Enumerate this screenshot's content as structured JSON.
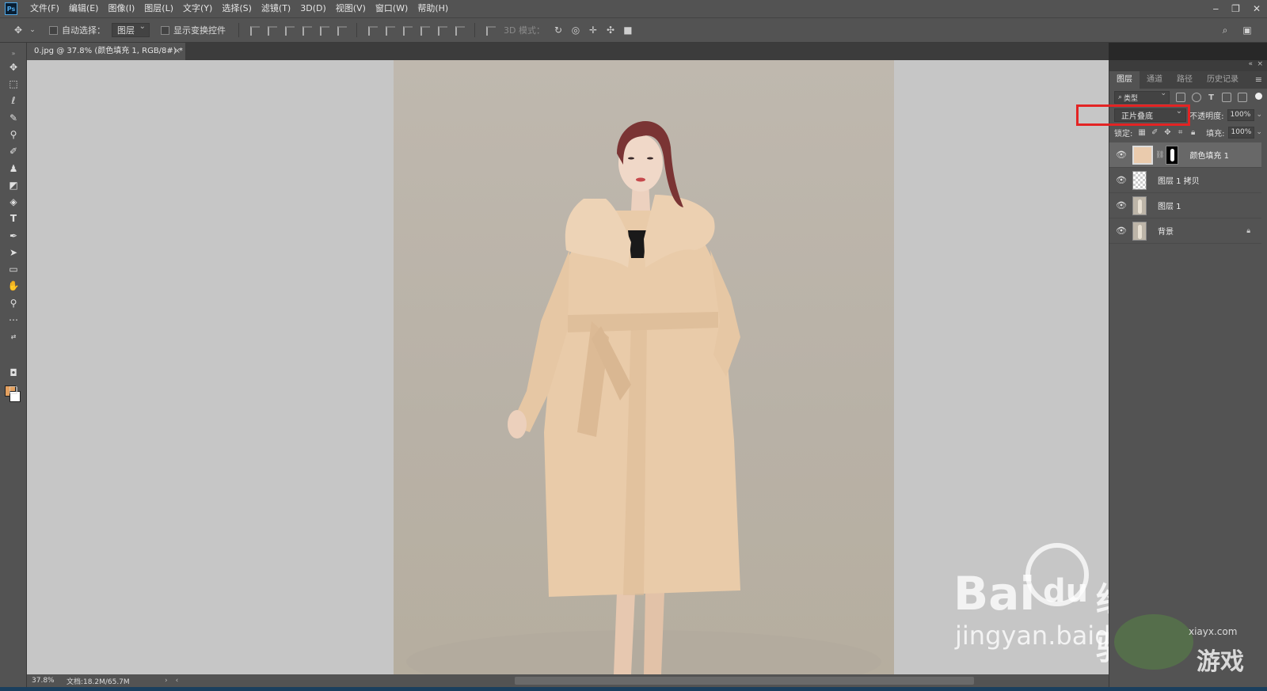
{
  "app": {
    "logo_text": "Ps"
  },
  "menu": [
    "文件(F)",
    "编辑(E)",
    "图像(I)",
    "图层(L)",
    "文字(Y)",
    "选择(S)",
    "滤镜(T)",
    "3D(D)",
    "视图(V)",
    "窗口(W)",
    "帮助(H)"
  ],
  "window_controls": {
    "minimize": "‒",
    "restore": "❐",
    "close": "✕"
  },
  "options": {
    "auto_select_label": "自动选择：",
    "auto_select_value": "图层",
    "transform_controls_label": "显示变换控件",
    "mode_3d_label": "3D 模式："
  },
  "document_tab": {
    "title": "0.jpg @ 37.8% (颜色填充 1, RGB/8#) *",
    "close": "×"
  },
  "status": {
    "zoom": "37.8%",
    "doc_info": "文档:18.2M/65.7M"
  },
  "panel": {
    "tabs": [
      "图层",
      "通道",
      "路径",
      "历史记录"
    ],
    "filter_kind": "类型",
    "blend_mode": "正片叠底",
    "opacity_label": "不透明度:",
    "opacity_value": "100%",
    "lock_label": "锁定:",
    "fill_label": "填充:",
    "fill_value": "100%"
  },
  "layers": [
    {
      "name": "颜色填充 1",
      "type": "fill",
      "selected": true,
      "visible": true
    },
    {
      "name": "图层 1 拷贝",
      "type": "transparent",
      "selected": false,
      "visible": true
    },
    {
      "name": "图层 1",
      "type": "photo",
      "selected": false,
      "visible": true
    },
    {
      "name": "背景",
      "type": "photo",
      "selected": false,
      "visible": true,
      "locked": true
    }
  ],
  "fill_color": "#eacbad",
  "foreground_color": "#e4a160",
  "background_color": "#ffffff",
  "highlight_color": "#e32424",
  "watermark": {
    "baidu_brand": "Bai",
    "baidu_du": "du",
    "baidu_cn": "经验",
    "baidu_url": "jingyan.baidu.com",
    "site_url": "xiayx.com",
    "site_cn": "游戏"
  }
}
